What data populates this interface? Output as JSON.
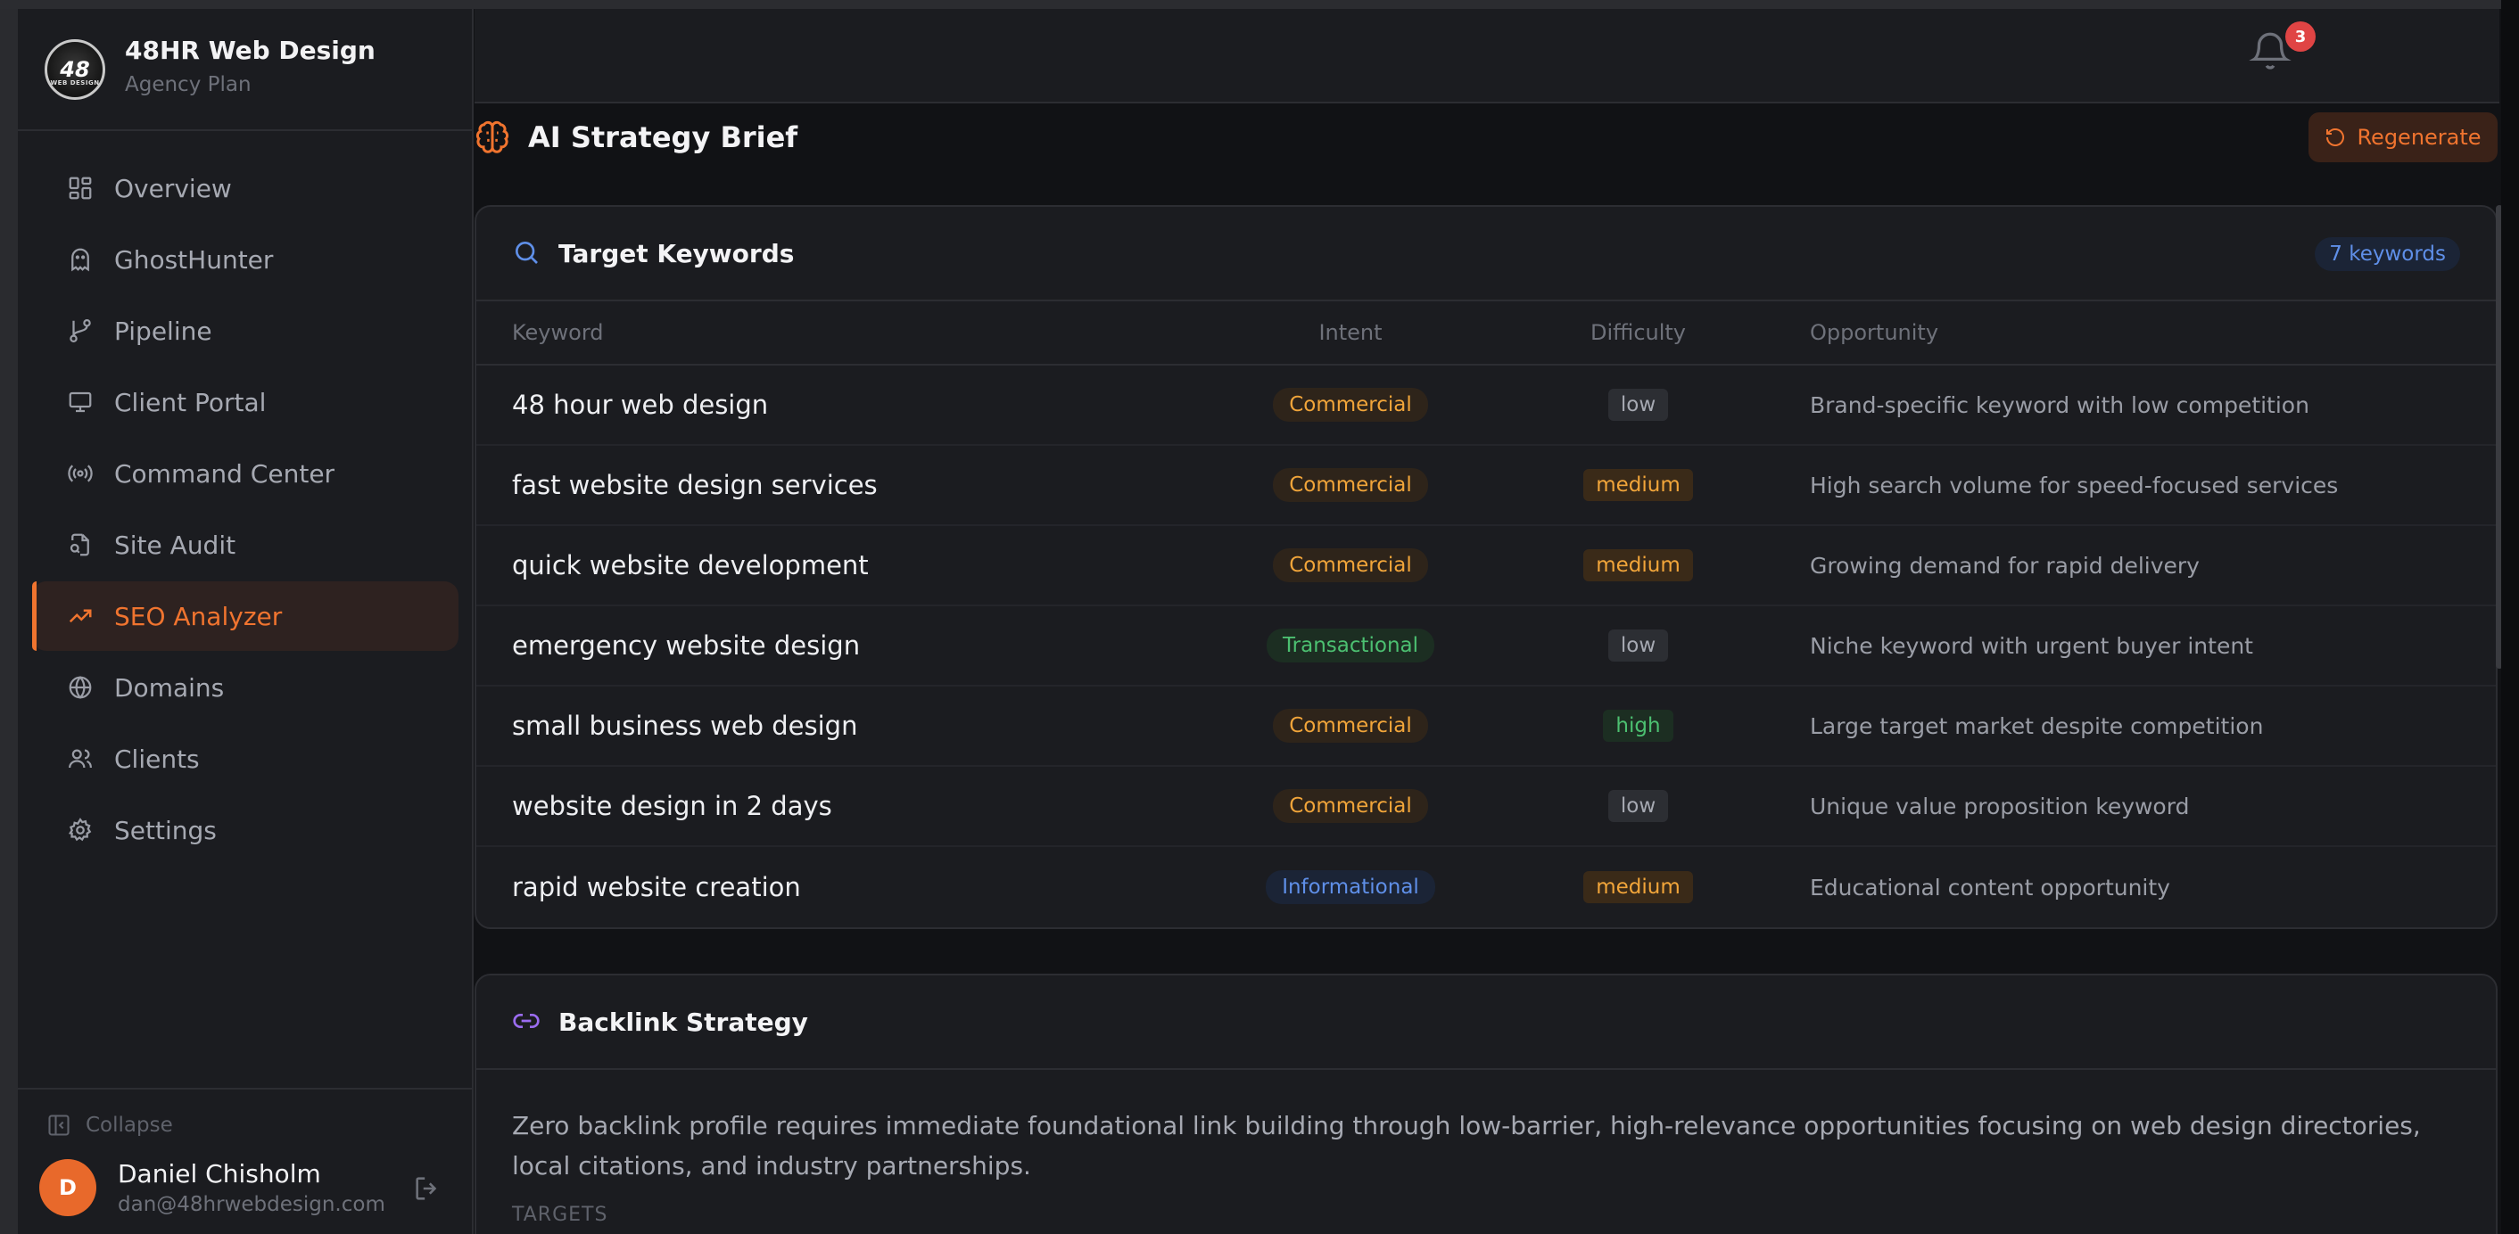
{
  "brand": {
    "name": "48HR Web Design",
    "plan": "Agency Plan",
    "logo_text": "48",
    "logo_sub": "WEB DESIGN"
  },
  "nav": {
    "items": [
      {
        "label": "Overview",
        "icon": "grid-icon"
      },
      {
        "label": "GhostHunter",
        "icon": "ghost-icon"
      },
      {
        "label": "Pipeline",
        "icon": "git-branch-icon"
      },
      {
        "label": "Client Portal",
        "icon": "monitor-icon"
      },
      {
        "label": "Command Center",
        "icon": "broadcast-icon"
      },
      {
        "label": "Site Audit",
        "icon": "file-search-icon"
      },
      {
        "label": "SEO Analyzer",
        "icon": "trending-up-icon",
        "active": true
      },
      {
        "label": "Domains",
        "icon": "globe-icon"
      },
      {
        "label": "Clients",
        "icon": "users-icon"
      },
      {
        "label": "Settings",
        "icon": "gear-icon"
      }
    ]
  },
  "sidebar_footer": {
    "collapse_label": "Collapse",
    "user_initial": "D",
    "user_name": "Daniel Chisholm",
    "user_email": "dan@48hrwebdesign.com"
  },
  "header": {
    "notification_count": "3"
  },
  "strategy": {
    "title": "AI Strategy Brief",
    "regenerate_label": "Regenerate"
  },
  "keywords": {
    "title": "Target Keywords",
    "count_label": "7 keywords",
    "columns": {
      "keyword": "Keyword",
      "intent": "Intent",
      "difficulty": "Difficulty",
      "opportunity": "Opportunity"
    },
    "rows": [
      {
        "keyword": "48 hour web design",
        "intent": "Commercial",
        "difficulty": "low",
        "opportunity": "Brand-specific keyword with low competition"
      },
      {
        "keyword": "fast website design services",
        "intent": "Commercial",
        "difficulty": "medium",
        "opportunity": "High search volume for speed-focused services"
      },
      {
        "keyword": "quick website development",
        "intent": "Commercial",
        "difficulty": "medium",
        "opportunity": "Growing demand for rapid delivery"
      },
      {
        "keyword": "emergency website design",
        "intent": "Transactional",
        "difficulty": "low",
        "opportunity": "Niche keyword with urgent buyer intent"
      },
      {
        "keyword": "small business web design",
        "intent": "Commercial",
        "difficulty": "high",
        "opportunity": "Large target market despite competition"
      },
      {
        "keyword": "website design in 2 days",
        "intent": "Commercial",
        "difficulty": "low",
        "opportunity": "Unique value proposition keyword"
      },
      {
        "keyword": "rapid website creation",
        "intent": "Informational",
        "difficulty": "medium",
        "opportunity": "Educational content opportunity"
      }
    ]
  },
  "backlink": {
    "title": "Backlink Strategy",
    "description": "Zero backlink profile requires immediate foundational link building through low-barrier, high-relevance opportunities focusing on web design directories, local citations, and industry partnerships.",
    "targets_label": "TARGETS"
  },
  "colors": {
    "accent": "#f0742f",
    "background": "#111215",
    "panel": "#1b1c20"
  }
}
